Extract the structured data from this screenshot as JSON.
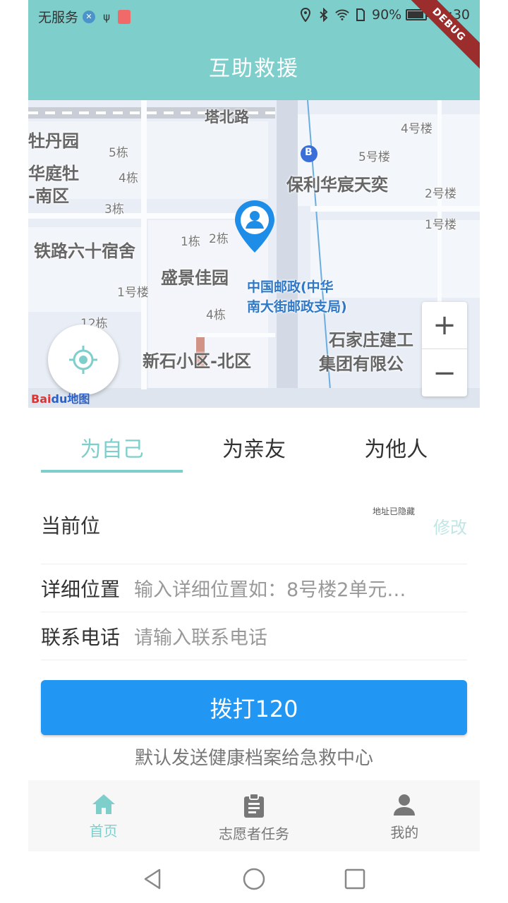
{
  "status_bar": {
    "carrier": "无服务",
    "battery": "90%",
    "battery_level": 0.9,
    "time": "10:30",
    "debug_badge": "DEBUG"
  },
  "app_bar": {
    "title": "互助救援"
  },
  "map": {
    "labels": {
      "road_north": "塔北路",
      "place_1": "牡丹园",
      "place_2": "华庭牡",
      "place_3": "-南区",
      "place_4": "铁路六十宿舍",
      "place_5": "盛景佳园",
      "place_6": "保利华宸天奕",
      "place_7": "新石小区-北区",
      "place_8": "石家庄建工",
      "place_9": "集团有限公",
      "poi_post": "中国邮政(中华",
      "poi_post_2": "南大街邮政支局)",
      "bld_5": "5栋",
      "bld_4": "4栋",
      "bld_3": "3栋",
      "bld_1": "1栋",
      "bld_2": "2栋",
      "bld_1lou": "1号楼",
      "bld_4b": "4栋",
      "bld_12": "12栋",
      "bld_4lou": "4号楼",
      "bld_5lou": "5号楼",
      "bld_2lou": "2号楼",
      "bld_1lou_b": "1号楼",
      "bus_stop": "B",
      "zoom_in": "+",
      "zoom_out": "−"
    },
    "logo_a": "Bai",
    "logo_b": "du地图"
  },
  "tabs": [
    {
      "label": "为自己",
      "active": true
    },
    {
      "label": "为亲友",
      "active": false
    },
    {
      "label": "为他人",
      "active": false
    }
  ],
  "form": {
    "current_location_label": "当前位",
    "hidden_address_note": "地址已隐藏",
    "change_label": "修改",
    "detail_label": "详细位置",
    "detail_placeholder": "输入详细位置如：8号楼2单元…",
    "phone_label": "联系电话",
    "phone_placeholder": "请输入联系电话"
  },
  "call_button": {
    "label": "拨打120"
  },
  "call_hint": "默认发送健康档案给急救中心",
  "bottom_nav": [
    {
      "label": "首页",
      "icon": "home-icon",
      "active": true
    },
    {
      "label": "志愿者任务",
      "icon": "clipboard-icon",
      "active": false
    },
    {
      "label": "我的",
      "icon": "person-icon",
      "active": false
    }
  ],
  "colors": {
    "accent": "#7ecfcc",
    "primary_button": "#2196f3",
    "debug_ribbon": "#9b2d2d"
  }
}
